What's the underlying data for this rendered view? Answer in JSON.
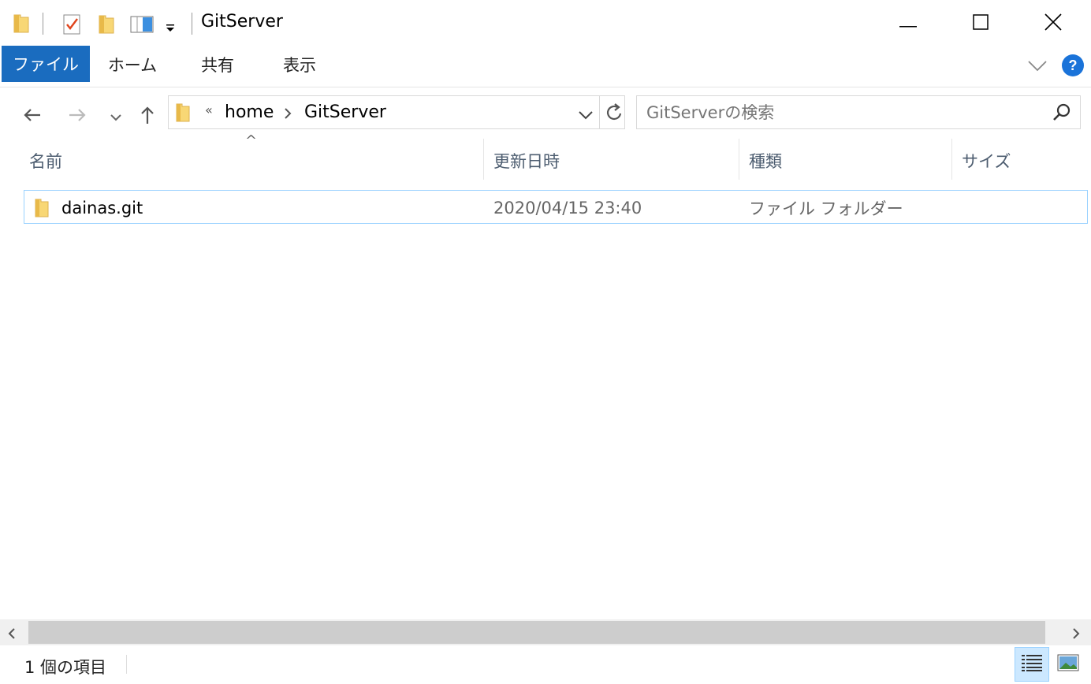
{
  "window": {
    "title": "GitServer",
    "controls": [
      "minimize-icon",
      "maximize-icon",
      "close-icon"
    ]
  },
  "ribbon": {
    "tabs": [
      {
        "label": "ファイル",
        "active": true
      },
      {
        "label": "ホーム"
      },
      {
        "label": "共有"
      },
      {
        "label": "表示"
      }
    ],
    "help_label": "?"
  },
  "nav": {
    "overflow": "«",
    "breadcrumb": [
      "home",
      "GitServer"
    ],
    "search_placeholder": "GitServerの検索"
  },
  "columns": {
    "name": "名前",
    "date": "更新日時",
    "type": "種類",
    "size": "サイズ",
    "sort_indicator": "^"
  },
  "files": [
    {
      "name": "dainas.git",
      "date": "2020/04/15 23:40",
      "type": "ファイル フォルダー",
      "size": ""
    }
  ],
  "status": {
    "count": "1 個の項目"
  },
  "colors": {
    "file_tab": "#1a6cbf",
    "selection_border": "#99d1ff",
    "folder": "#f8d775",
    "help_badge": "#1a73d9"
  }
}
